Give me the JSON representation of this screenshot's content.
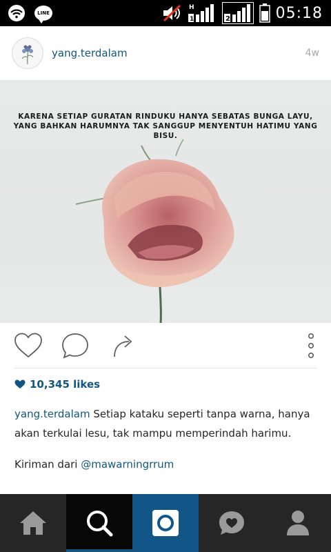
{
  "status_bar": {
    "line_label": "LINE",
    "network_h": "H",
    "sim1": "1",
    "sim2": "2",
    "time": "05:18"
  },
  "post": {
    "username": "yang.terdalam",
    "age": "4w",
    "image_text_line1": "KARENA SETIAP GURATAN RINDUKU HANYA SEBATAS BUNGA LAYU,",
    "image_text_line2": "YANG BAHKAN HARUMNYA TAK SANGGUP MENYENTUH HATIMU YANG BISU.",
    "likes": "10,345 likes",
    "caption_user": "yang.terdalam",
    "caption_text": " Setiap kataku seperti tanpa warna, hanya akan terkulai lesu, tak mampu memperindah harimu.",
    "credit_prefix": "Kiriman dari ",
    "credit_mention": "@mawarningrrum"
  },
  "icons": {
    "like": "heart-icon",
    "comment": "comment-icon",
    "share": "share-icon",
    "more": "more-options-icon"
  },
  "bottom_nav": [
    "home",
    "search",
    "camera",
    "activity",
    "profile"
  ],
  "colors": {
    "accent": "#12567f",
    "nav_bg": "#262626",
    "camera_tab": "#125688"
  }
}
